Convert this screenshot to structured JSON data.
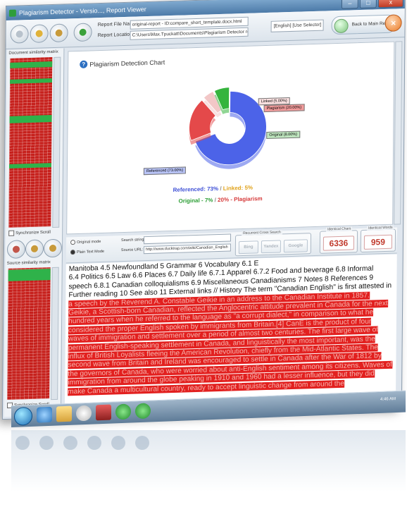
{
  "window": {
    "title": "Plagiarism Detector - Versio..., Report Viewer",
    "controls": [
      "–",
      "□",
      "x"
    ]
  },
  "toolbar": {
    "report_file_label": "Report File Name:",
    "report_file_value": "original-report - ID:compare_short_template.docx.html",
    "report_location_label": "Report Location:",
    "report_location_value": "C:\\Users\\Max.Tpuckatt\\Documents\\Plagiarism Detector reports\\pd report",
    "language_select": "[English] [Use Selector]",
    "back_button": "Back to Main Report",
    "close_glyph": "×"
  },
  "left_pane": {
    "doc_matrix_label": "Document similarity matrix",
    "source_matrix_label": "Source similarity matrix",
    "sync_label": "Synchronize Scroll"
  },
  "chart": {
    "title": "Plagiarism Detection Chart",
    "callouts": {
      "linked": "Linked (5.00%)",
      "plagiarism": "Plagiarism (20.00%)",
      "original": "Original (8.00%)",
      "referenced": "Referenced (73.00%)"
    },
    "legend_line1_a": "Referenced: 73%",
    "legend_line1_sep": " / ",
    "legend_line1_b": "Linked: 5%",
    "legend_line2_a": "Original - 7%",
    "legend_line2_sep": " / ",
    "legend_line2_b": "20% - Plagiarism",
    "colors": {
      "referenced": "#4c63e8",
      "plagiarism": "#e4494a",
      "linked": "#f2c7c7",
      "original": "#35b43d"
    }
  },
  "chart_data": {
    "type": "pie",
    "title": "Plagiarism Detection Chart",
    "slices": [
      {
        "label": "Referenced",
        "value": 73
      },
      {
        "label": "Plagiarism",
        "value": 20
      },
      {
        "label": "Linked",
        "value": 5
      },
      {
        "label": "Original",
        "value": 7
      }
    ]
  },
  "lower_bar": {
    "original_mode": "Original mode",
    "plain_text_mode": "Plain Text Mode",
    "search_string_label": "Search string:",
    "source_url_label": "Source URL:",
    "source_url_value": "http://www.ducktrap.com/wiki/Canadian_English",
    "search_group_label": "Recurrent Cross Search",
    "search_buttons": [
      "Bing",
      "Yandex",
      "Google"
    ],
    "identical_chars_label": "Identical Chars",
    "identical_chars_value": "6336",
    "identical_words_label": "Identical Words",
    "identical_words_value": "959"
  },
  "text": {
    "line_a": "Manitoba 4.5 Newfoundland 5 Grammar 6 Vocabulary 6.1 E",
    "line_b": "6.4 Politics 6.5 Law 6.6 Places 6.7 Daily life 6.7.1 Apparel 6.7.2 Food and beverage 6.8 Informal speech 6.8.1 Canadian colloquialisms 6.9 Miscellaneous Canadianisms 7 Notes 8 References 9 Further reading 10 See also 11 External links // History The term \"Canadian English\" is first attested in ",
    "highlight": "a speech by the Reverend A. Constable Geikie in an address to the Canadian Institute in 1857. Geikie, a Scottish-born Canadian, reflected the Anglocentric attitude prevalent in Canada for the next hundred years when he referred to the language as \"a corrupt dialect,\" in comparison to what he considered the proper English spoken by immigrants from Britain.[4] CanE is the product of four waves of immigration and settlement over a period of almost two centuries. The first large wave of permanent English-speaking settlement in Canada, and linguistically the most important, was the influx of British Loyalists fleeing the American Revolution, chiefly from the Mid-Atlantic States. The second wave from Britain and Ireland was encouraged to settle in Canada after the War of 1812 by the governors of Canada, who were worried about anti-English sentiment among its citizens. Waves of immigration from around the globe peaking in 1910 and 1960 had a lesser influence, but they did make Canada a multicultural country, ready to accept linguistic change from around the"
  },
  "taskbar": {
    "tray_text": "4:46 AM"
  }
}
